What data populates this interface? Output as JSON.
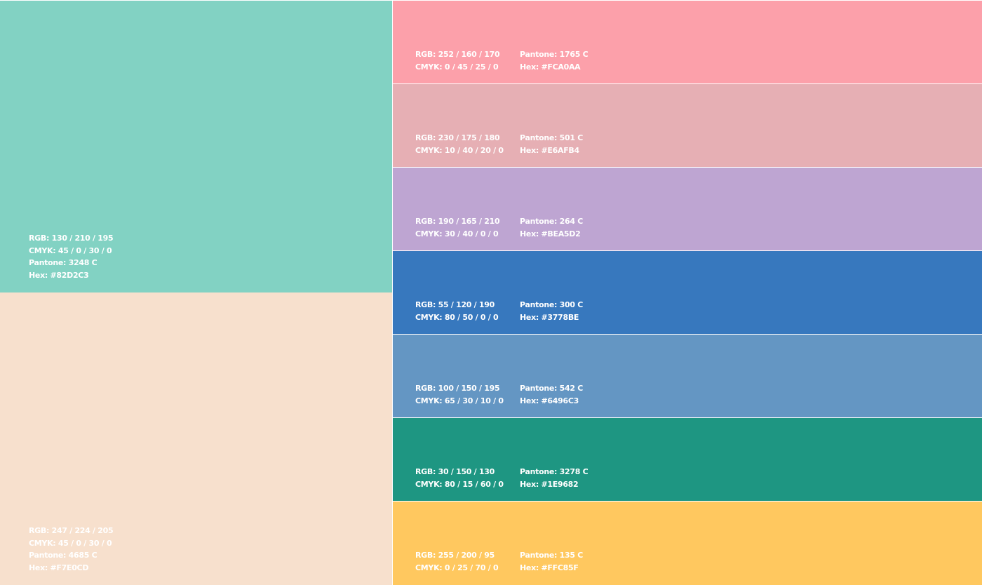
{
  "large_swatches": [
    {
      "color": "#82D2C3",
      "rgb": "RGB: 130 / 210 / 195",
      "cmyk": "CMYK: 45 / 0 / 30 / 0",
      "pantone": "Pantone: 3248 C",
      "hex": "Hex: #82D2C3"
    },
    {
      "color": "#F7E0CD",
      "rgb": "RGB: 247 / 224 / 205",
      "cmyk": "CMYK: 45 / 0 / 30 / 0",
      "pantone": "Pantone: 4685 C",
      "hex": "Hex: #F7E0CD"
    }
  ],
  "strips": [
    {
      "color": "#FCA0AA",
      "rgb": "RGB: 252 / 160 / 170",
      "cmyk": "CMYK: 0 / 45 / 25 / 0",
      "pantone": "Pantone: 1765 C",
      "hex": "Hex: #FCA0AA"
    },
    {
      "color": "#E6AFB4",
      "rgb": "RGB: 230 / 175 / 180",
      "cmyk": "CMYK: 10 / 40 / 20 / 0",
      "pantone": "Pantone: 501 C",
      "hex": "Hex: #E6AFB4"
    },
    {
      "color": "#BEA5D2",
      "rgb": "RGB: 190 / 165 / 210",
      "cmyk": "CMYK: 30 / 40 / 0 / 0",
      "pantone": "Pantone: 264 C",
      "hex": "Hex: #BEA5D2"
    },
    {
      "color": "#3778BE",
      "rgb": "RGB: 55 / 120 / 190",
      "cmyk": "CMYK: 80 / 50 / 0 / 0",
      "pantone": "Pantone: 300 C",
      "hex": "Hex: #3778BE"
    },
    {
      "color": "#6496C3",
      "rgb": "RGB: 100 / 150 / 195",
      "cmyk": "CMYK: 65 / 30 / 10 / 0",
      "pantone": "Pantone: 542 C",
      "hex": "Hex: #6496C3"
    },
    {
      "color": "#1E9682",
      "rgb": "RGB: 30 / 150 / 130",
      "cmyk": "CMYK: 80 / 15 / 60 / 0",
      "pantone": "Pantone: 3278 C",
      "hex": "Hex: #1E9682"
    },
    {
      "color": "#FFC85F",
      "rgb": "RGB: 255 / 200 / 95",
      "cmyk": "CMYK: 0 / 25 / 70 / 0",
      "pantone": "Pantone: 135 C",
      "hex": "Hex: #FFC85F"
    }
  ]
}
